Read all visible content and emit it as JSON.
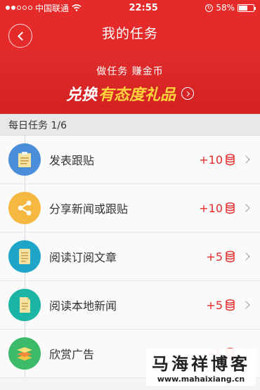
{
  "status_bar": {
    "carrier": "中国联通",
    "time": "22:55",
    "battery": "58%",
    "battery_level": 0.58
  },
  "navbar": {
    "title": "我的任务"
  },
  "banner": {
    "subtitle": "做任务  赚金币",
    "main_white": "兑换",
    "main_yellow": "有态度礼品"
  },
  "section": {
    "header": "每日任务 1/6"
  },
  "tasks": [
    {
      "label": "发表跟贴",
      "reward": "+10",
      "icon": "clipboard-icon",
      "color": "#4a8ed9"
    },
    {
      "label": "分享新闻或跟贴",
      "reward": "+10",
      "icon": "share-icon",
      "color": "#f5b942"
    },
    {
      "label": "阅读订阅文章",
      "reward": "+5",
      "icon": "scroll-icon",
      "color": "#1ea5c8"
    },
    {
      "label": "阅读本地新闻",
      "reward": "+5",
      "icon": "document-icon",
      "color": "#1ab5a5"
    },
    {
      "label": "欣赏广告",
      "reward": "+5",
      "icon": "layers-icon",
      "color": "#3bba6a"
    }
  ],
  "watermark": {
    "title": "马海祥博客",
    "url": "www.mahaixiang.cn"
  }
}
